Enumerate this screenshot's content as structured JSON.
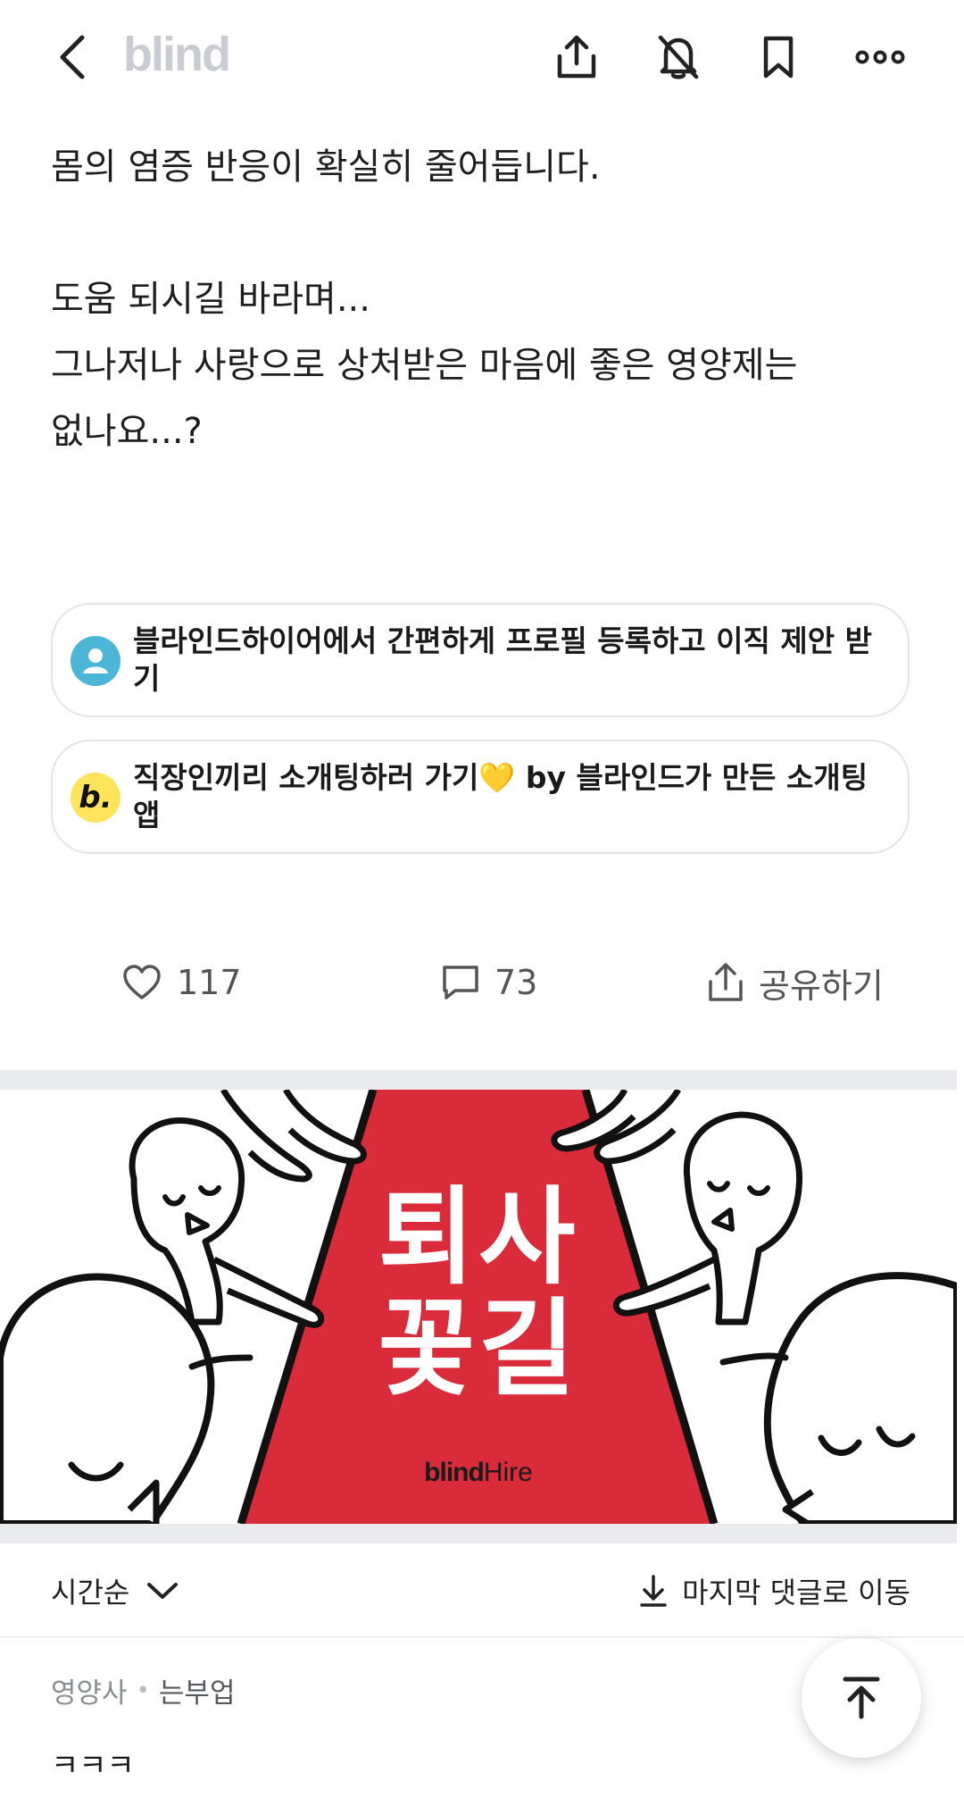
{
  "header": {
    "logo": "blind",
    "icons": [
      "back-icon",
      "share-icon",
      "bell-off-icon",
      "bookmark-icon",
      "more-icon"
    ]
  },
  "post": {
    "lines": [
      "몸의 염증 반응이 확실히 줄어듭니다.",
      "",
      "도움 되시길 바라며...",
      "그나저나 사랑으로 상처받은 마음에 좋은 영양제는",
      "없나요...?"
    ]
  },
  "promos": [
    {
      "text": "블라인드하이어에서 간편하게 프로필 등록하고 이직 제안 받기",
      "icon": "profile-icon"
    },
    {
      "text": "직장인끼리 소개팅하러 가기💛 by 블라인드가 만든 소개팅앱",
      "icon": "blind-b-icon",
      "icon_letter": "b."
    }
  ],
  "actions": {
    "likes": "117",
    "comments": "73",
    "share_label": "공유하기"
  },
  "banner": {
    "line1": "퇴사",
    "line2": "꽃길",
    "brand": "blind",
    "brand_suffix": "Hire",
    "carpet_color": "#da2b3a"
  },
  "comments_bar": {
    "sort_label": "시간순",
    "jump_label": "마지막 댓글로 이동"
  },
  "comments": [
    {
      "company": "영양사",
      "nickname": "는부업",
      "text": "ㅋㅋㅋ"
    }
  ]
}
